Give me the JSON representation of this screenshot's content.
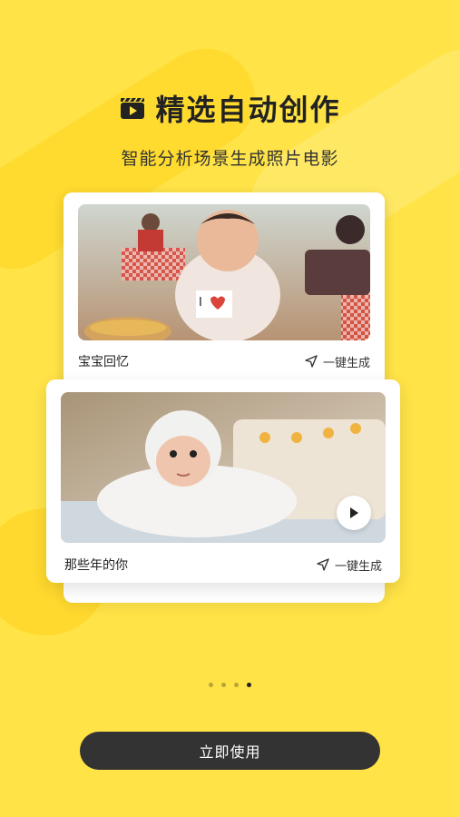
{
  "header": {
    "title": "精选自动创作",
    "subtitle": "智能分析场景生成照片电影",
    "icon": "clapperboard-icon"
  },
  "cards": [
    {
      "label": "宝宝回忆",
      "action": "一键生成",
      "photo": "baby-eating-photo"
    },
    {
      "label": "那些年的你",
      "action": "一键生成",
      "photo": "baby-in-white-hat-photo"
    }
  ],
  "pagination": {
    "total": 4,
    "active_index": 4
  },
  "cta": {
    "label": "立即使用"
  },
  "colors": {
    "background": "#FFE347",
    "button": "#333333",
    "button_text": "#FFFFFF"
  }
}
